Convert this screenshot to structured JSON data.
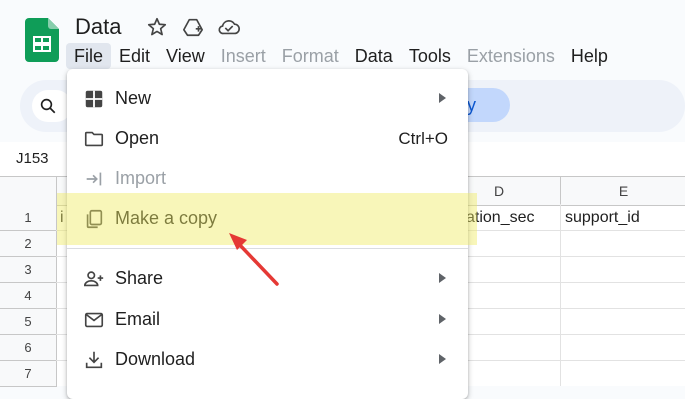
{
  "document": {
    "title": "Data"
  },
  "menubar": [
    {
      "label": "File",
      "state": "active"
    },
    {
      "label": "Edit",
      "state": "normal"
    },
    {
      "label": "View",
      "state": "normal"
    },
    {
      "label": "Insert",
      "state": "disabled"
    },
    {
      "label": "Format",
      "state": "disabled"
    },
    {
      "label": "Data",
      "state": "normal"
    },
    {
      "label": "Tools",
      "state": "normal"
    },
    {
      "label": "Extensions",
      "state": "disabled"
    },
    {
      "label": "Help",
      "state": "normal"
    }
  ],
  "toolbar": {
    "chip_partial_text": "ly"
  },
  "name_box": {
    "value": "J153"
  },
  "columns": [
    "D",
    "E"
  ],
  "rows": [
    "1",
    "2",
    "3",
    "4",
    "5",
    "6",
    "7"
  ],
  "cells": {
    "A1_partial": "i",
    "D1_partial": "ation_sec",
    "E1": "support_id"
  },
  "file_menu": {
    "items": [
      {
        "label": "New",
        "icon": "grid-plus-icon",
        "submenu": true
      },
      {
        "label": "Open",
        "icon": "folder-icon",
        "shortcut": "Ctrl+O"
      },
      {
        "label": "Import",
        "icon": "import-arrow-icon",
        "disabled": true
      },
      {
        "label": "Make a copy",
        "icon": "copy-icon"
      },
      {
        "label": "Share",
        "icon": "person-add-icon",
        "submenu": true
      },
      {
        "label": "Email",
        "icon": "mail-icon",
        "submenu": true
      },
      {
        "label": "Download",
        "icon": "download-icon",
        "submenu": true
      }
    ]
  },
  "colors": {
    "accent": "#0b57d0",
    "sheets_green": "#0f9d58",
    "highlight": "#f3ee7a",
    "pointer": "#e53935"
  }
}
